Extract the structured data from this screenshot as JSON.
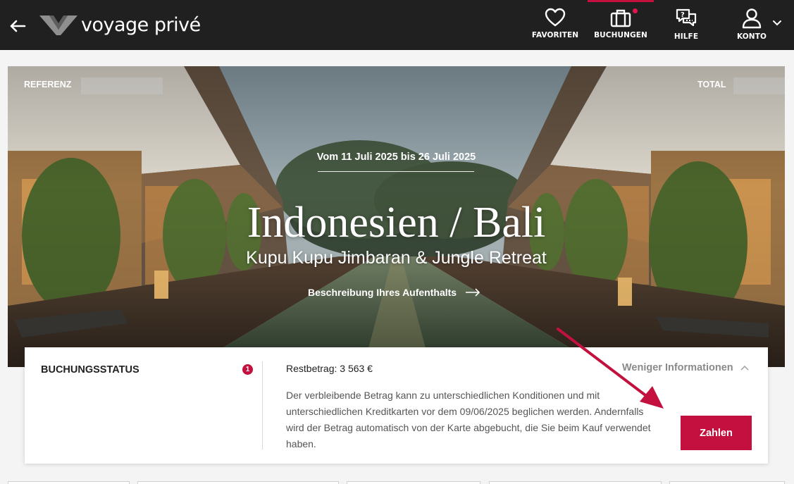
{
  "brand": {
    "name": "voyage privé",
    "accent": "#c4103f",
    "topbar_bg": "#202020"
  },
  "nav": {
    "back_icon": "arrow-left-icon",
    "items": [
      {
        "label": "FAVORITEN",
        "icon": "heart-icon"
      },
      {
        "label": "BUCHUNGEN",
        "icon": "suitcase-icon",
        "active": true,
        "notification": true
      },
      {
        "label": "HILFE",
        "icon": "help-chat-icon"
      },
      {
        "label": "KONTO",
        "icon": "user-icon"
      }
    ],
    "account_dropdown_icon": "chevron-down-icon"
  },
  "hero": {
    "reference_label": "REFERENZ",
    "total_label": "TOTAL",
    "dates": "Vom 11 Juli 2025 bis 26 Juli 2025",
    "title": "Indonesien / Bali",
    "subtitle": "Kupu Kupu Jimbaran & Jungle Retreat",
    "description_link": "Beschreibung Ihres Aufenthalts"
  },
  "booking_status": {
    "title": "BUCHUNGSSTATUS",
    "badge_count": "1",
    "remaining": "Restbetrag: 3 563 €",
    "toggle_label": "Weniger Informationen",
    "info_text": "Der verbleibende Betrag kann zu unterschiedlichen Konditionen und mit unterschiedlichen Kreditkarten vor dem 09/06/2025 beglichen werden. Andernfalls wird der Betrag automatisch von der Karte abgebucht, die Sie beim Kauf verwendet haben.",
    "pay_button": "Zahlen"
  }
}
